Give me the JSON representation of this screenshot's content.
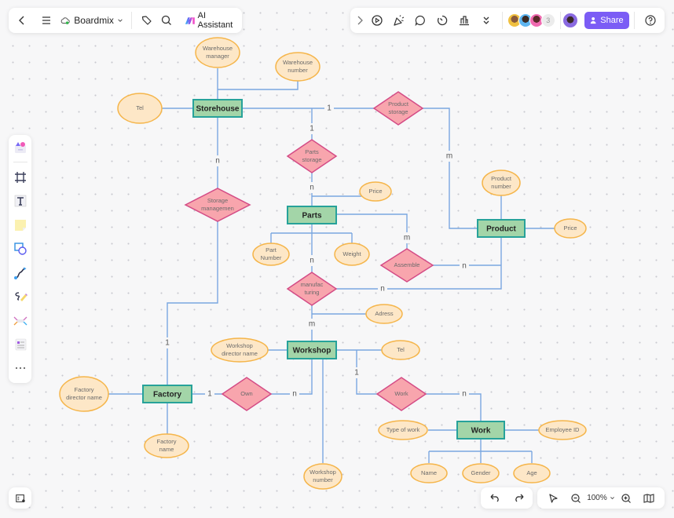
{
  "app": {
    "board_name": "Boardmix",
    "ai_assistant_label": "AI Assistant",
    "share_label": "Share",
    "collaborator_extra_count": "3",
    "zoom_level": "100%",
    "brand_color": "#7b5cf5"
  },
  "toolbar_top_left": {
    "icons": [
      "back-icon",
      "menu-icon",
      "cloud-icon",
      "chevron-down-icon",
      "tag-icon",
      "search-icon",
      "ai-assistant-icon"
    ]
  },
  "toolbar_top_right": {
    "icons": [
      "expand-icon",
      "present-icon",
      "celebrate-icon",
      "comment-icon",
      "timer-icon",
      "vote-icon",
      "more-icon",
      "help-icon"
    ]
  },
  "left_toolbar": {
    "tools": [
      "templates",
      "frame",
      "text",
      "sticky-note",
      "shape",
      "connector",
      "pen",
      "mind-map",
      "list",
      "more"
    ]
  },
  "diagram": {
    "colors": {
      "entity_fill": "#a3d5a8",
      "entity_stroke": "#27a29a",
      "relation_fill": "#f8a5ad",
      "relation_stroke": "#d44c86",
      "attribute_fill": "#fde7c7",
      "attribute_stroke": "#f5b54a",
      "edge": "#7aa7e0"
    },
    "entities": [
      {
        "id": "storehouse",
        "label": "Storehouse"
      },
      {
        "id": "parts",
        "label": "Parts"
      },
      {
        "id": "product",
        "label": "Product"
      },
      {
        "id": "workshop",
        "label": "Workshop"
      },
      {
        "id": "factory",
        "label": "Factory"
      },
      {
        "id": "work",
        "label": "Work"
      }
    ],
    "relations": [
      {
        "id": "product_storage",
        "lines": [
          "Product",
          "storage"
        ]
      },
      {
        "id": "parts_storage",
        "lines": [
          "Parts",
          "storage"
        ]
      },
      {
        "id": "storage_management",
        "lines": [
          "Storage",
          "managemen"
        ]
      },
      {
        "id": "assemble",
        "lines": [
          "Assemble"
        ]
      },
      {
        "id": "manufacturing",
        "lines": [
          "manufac",
          "turing"
        ]
      },
      {
        "id": "own",
        "lines": [
          "Own"
        ]
      },
      {
        "id": "work_rel",
        "lines": [
          "Work"
        ]
      }
    ],
    "attributes": [
      {
        "id": "warehouse_manager",
        "lines": [
          "Warehouse",
          "manager"
        ]
      },
      {
        "id": "warehouse_number",
        "lines": [
          "Warehouse",
          "number"
        ]
      },
      {
        "id": "storehouse_tel",
        "lines": [
          "Tel"
        ]
      },
      {
        "id": "parts_price",
        "lines": [
          "Price"
        ]
      },
      {
        "id": "part_number",
        "lines": [
          "Part",
          "Number"
        ]
      },
      {
        "id": "weight",
        "lines": [
          "Weight"
        ]
      },
      {
        "id": "product_number",
        "lines": [
          "Product",
          "number"
        ]
      },
      {
        "id": "product_price",
        "lines": [
          "Price"
        ]
      },
      {
        "id": "adress",
        "lines": [
          "Adress"
        ]
      },
      {
        "id": "workshop_director",
        "lines": [
          "Workshop",
          "director name"
        ]
      },
      {
        "id": "workshop_tel",
        "lines": [
          "Tel"
        ]
      },
      {
        "id": "workshop_number",
        "lines": [
          "Workshop",
          "number"
        ]
      },
      {
        "id": "factory_director",
        "lines": [
          "Factory",
          "director name"
        ]
      },
      {
        "id": "factory_name",
        "lines": [
          "Factory",
          "name"
        ]
      },
      {
        "id": "type_of_work",
        "lines": [
          "Type of work"
        ]
      },
      {
        "id": "employee_id",
        "lines": [
          "Employee ID"
        ]
      },
      {
        "id": "name",
        "lines": [
          "Name"
        ]
      },
      {
        "id": "gender",
        "lines": [
          "Gender"
        ]
      },
      {
        "id": "age",
        "lines": [
          "Age"
        ]
      }
    ],
    "cardinalities": [
      {
        "id": "storehouse_productstorage",
        "label": "1"
      },
      {
        "id": "storehouse_partsstorage",
        "label": "1"
      },
      {
        "id": "partsstorage_parts",
        "label": "n"
      },
      {
        "id": "productstorage_product",
        "label": "m"
      },
      {
        "id": "storehouse_storagemgmt",
        "label": "n"
      },
      {
        "id": "parts_assemble",
        "label": "m"
      },
      {
        "id": "assemble_product",
        "label": "n"
      },
      {
        "id": "parts_manufacturing",
        "label": "n"
      },
      {
        "id": "manufacturing_product",
        "label": "n"
      },
      {
        "id": "manufacturing_workshop",
        "label": "m"
      },
      {
        "id": "storagemgmt_factory",
        "label": "1"
      },
      {
        "id": "factory_own",
        "label": "1"
      },
      {
        "id": "own_workshop",
        "label": "n"
      },
      {
        "id": "workshop_work",
        "label": "1"
      },
      {
        "id": "work_workentity",
        "label": "n"
      }
    ]
  }
}
